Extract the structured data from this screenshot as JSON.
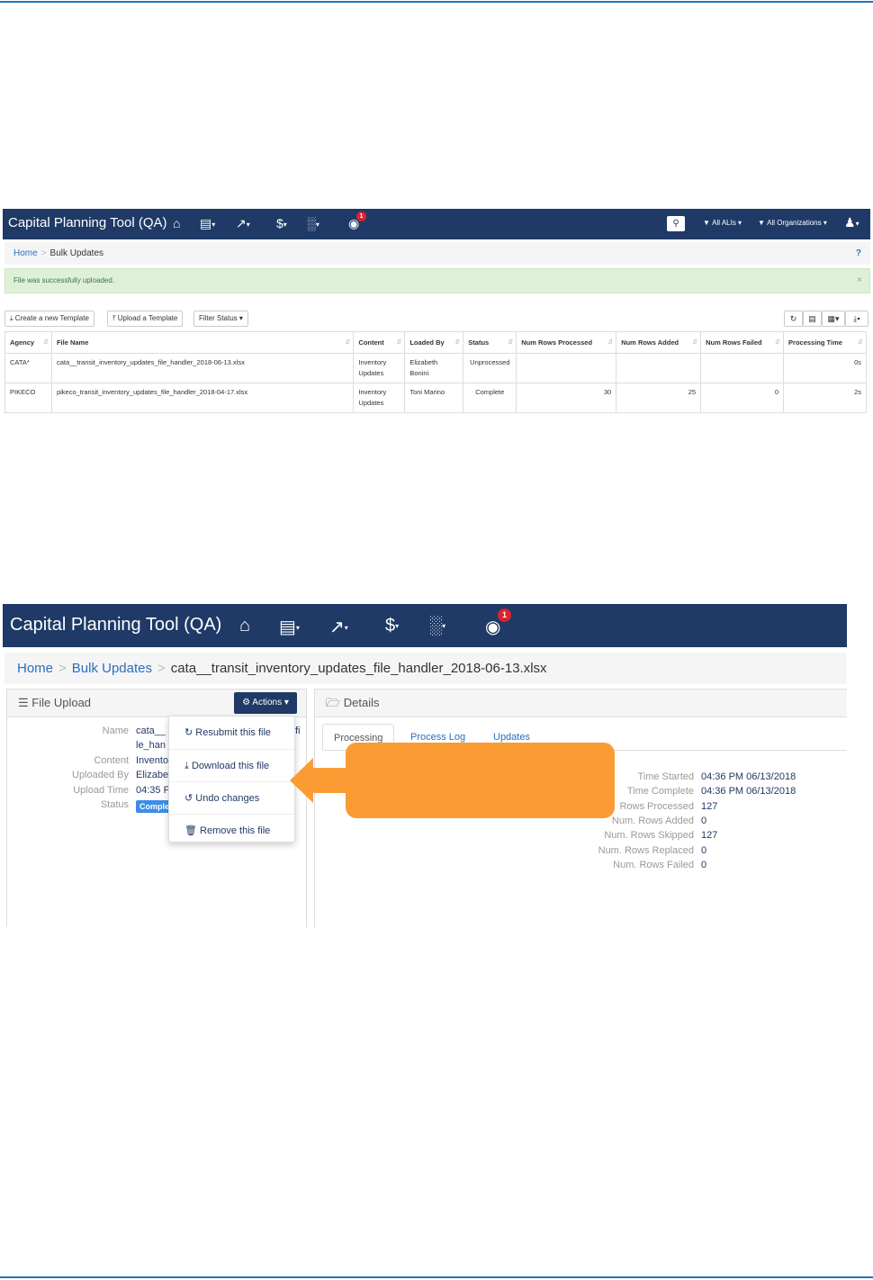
{
  "navbar": {
    "brand": "Capital Planning Tool (QA)",
    "icons": [
      "home-icon",
      "bus-icon",
      "line-chart-icon",
      "dollar-icon",
      "bar-chart-icon",
      "globe-icon"
    ],
    "notification_count": "1",
    "filter_all_ali": "All ALIs",
    "filter_all_orgs": "All Organizations"
  },
  "screen1": {
    "breadcrumb": {
      "home": "Home",
      "current": "Bulk Updates",
      "help": "?"
    },
    "alert": {
      "text": "File was successfully uploaded.",
      "close": "×"
    },
    "toolbar": {
      "create": "Create a new Template",
      "upload": "Upload a Template",
      "filter": "Filter Status"
    },
    "table": {
      "headers": [
        "Agency",
        "File Name",
        "Content",
        "Loaded By",
        "Status",
        "Num Rows Processed",
        "Num Rows Added",
        "Num Rows Failed",
        "Processing Time"
      ],
      "rows": [
        {
          "agency": "CATA*",
          "file": "cata__transit_inventory_updates_file_handler_2018-06-13.xlsx",
          "content1": "Inventory",
          "content2": "Updates",
          "loaded1": "Elizabeth",
          "loaded2": "Bonini",
          "status": "Unprocessed",
          "processed": "",
          "added": "",
          "failed": "",
          "time": "0s"
        },
        {
          "agency": "PIKECO",
          "file": "pikeco_transit_inventory_updates_file_handler_2018-04-17.xlsx",
          "content1": "Inventory",
          "content2": "Updates",
          "loaded1": "Toni Marino",
          "loaded2": "",
          "status": "Complete",
          "processed": "30",
          "added": "25",
          "failed": "0",
          "time": "2s"
        }
      ]
    }
  },
  "screen2": {
    "breadcrumb": {
      "home": "Home",
      "bulk": "Bulk Updates",
      "current": "cata__transit_inventory_updates_file_handler_2018-06-13.xlsx"
    },
    "file_panel": {
      "title": "File Upload",
      "actions_label": "Actions",
      "labels": {
        "name": "Name",
        "content": "Content",
        "uploaded_by": "Uploaded By",
        "upload_time": "Upload Time",
        "status": "Status"
      },
      "values": {
        "name1": "cata__",
        "name_tail": "fi",
        "name2": "le_han",
        "content": "Invento",
        "uploaded_by": "Elizabe",
        "upload_time": "04:35 P",
        "status": "Comple"
      }
    },
    "actions_menu": [
      "Resubmit this file",
      "Download this file",
      "Undo changes",
      "Remove this file"
    ],
    "details_panel": {
      "title": "Details",
      "tabs": [
        "Processing",
        "Process Log",
        "Updates"
      ],
      "rows": [
        {
          "label": "Time Started",
          "value": "04:36 PM 06/13/2018"
        },
        {
          "label": "Time Complete",
          "value": "04:36 PM 06/13/2018"
        },
        {
          "label": "Rows Processed",
          "value": "127"
        },
        {
          "label": "Num. Rows Added",
          "value": "0"
        },
        {
          "label": "Num. Rows Skipped",
          "value": "127"
        },
        {
          "label": "Num. Rows Replaced",
          "value": "0"
        },
        {
          "label": "Num. Rows Failed",
          "value": "0"
        }
      ]
    }
  },
  "colors": {
    "navbar": "#1f3a66",
    "link": "#2a6fc0",
    "callout": "#fa9c33",
    "badge": "#d9232e",
    "alert_bg": "#dff0d8"
  }
}
